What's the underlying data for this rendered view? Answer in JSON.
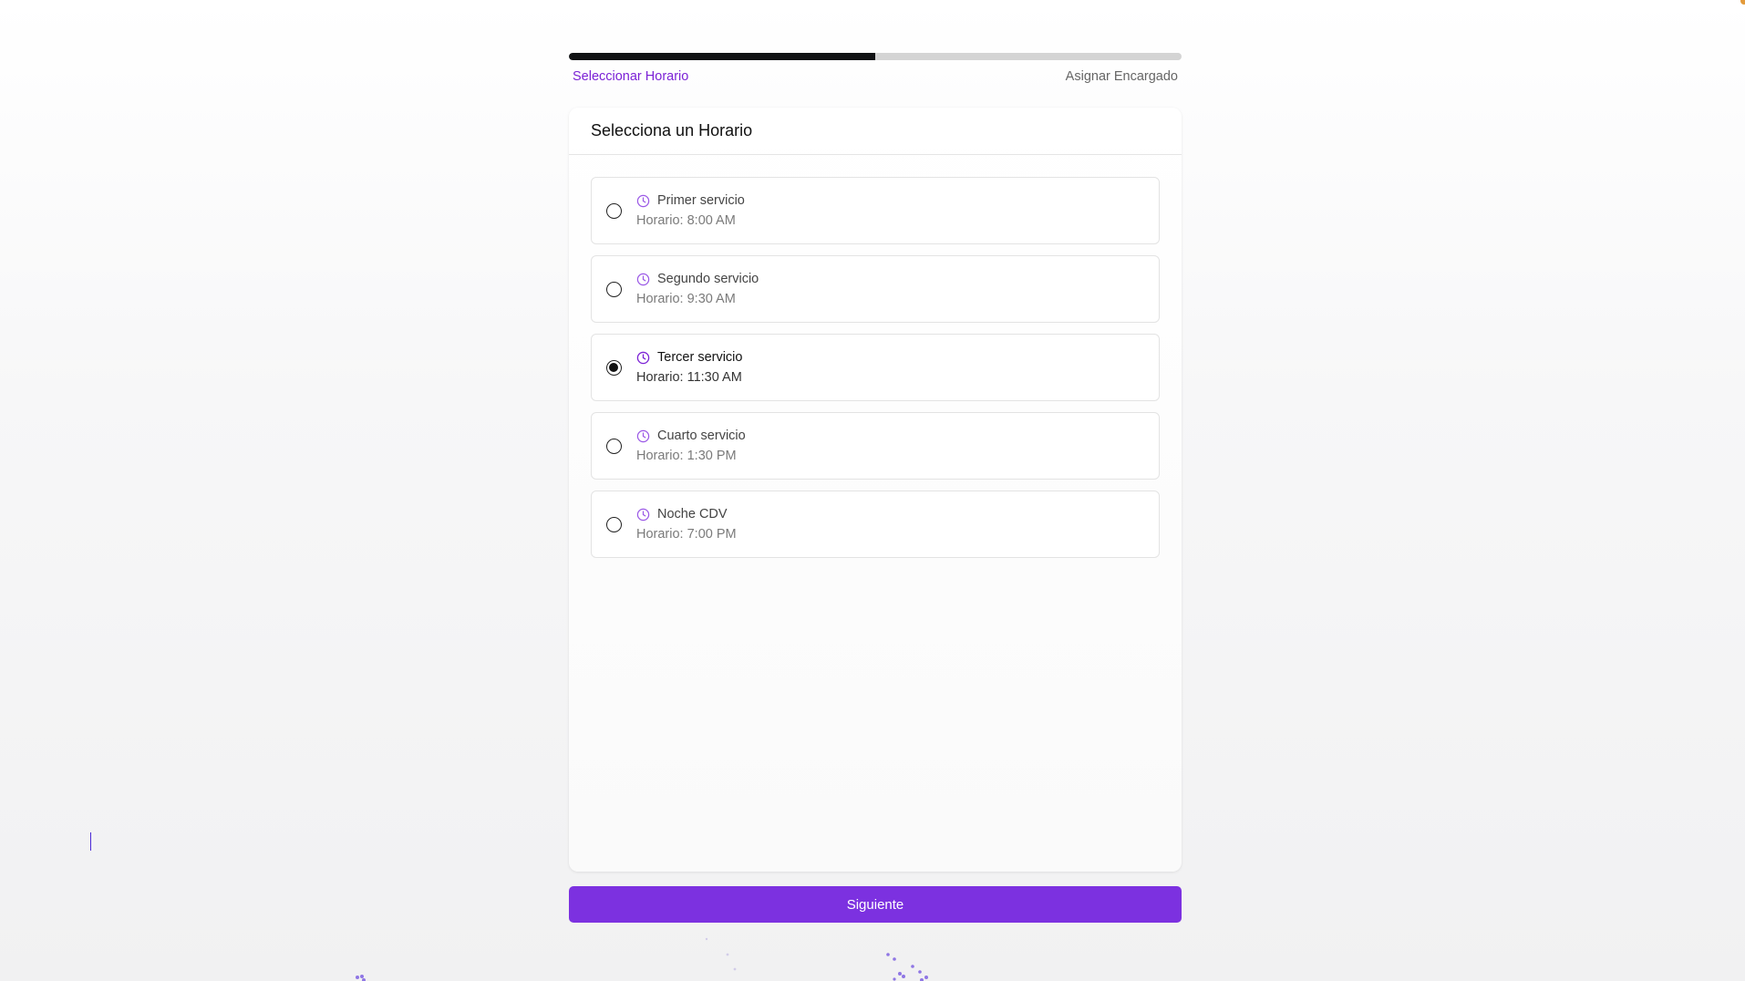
{
  "progress": {
    "value_fraction": 0.5
  },
  "steps": {
    "current": "Seleccionar Horario",
    "next": "Asignar Encargado"
  },
  "card": {
    "title": "Selecciona un Horario"
  },
  "options": [
    {
      "name": "Primer servicio",
      "time": "Horario: 8:00 AM",
      "selected": false
    },
    {
      "name": "Segundo servicio",
      "time": "Horario: 9:30 AM",
      "selected": false
    },
    {
      "name": "Tercer servicio",
      "time": "Horario: 11:30 AM",
      "selected": true
    },
    {
      "name": "Cuarto servicio",
      "time": "Horario: 1:30 PM",
      "selected": false
    },
    {
      "name": "Noche CDV",
      "time": "Horario: 7:00 PM",
      "selected": false
    }
  ],
  "actions": {
    "next_label": "Siguiente"
  },
  "colors": {
    "accent": "#7c31e0",
    "step_active": "#7c22d6",
    "progress_fill": "#111214",
    "progress_track": "#d4d4d4"
  },
  "icons": {
    "option_icon": "clock-icon"
  }
}
